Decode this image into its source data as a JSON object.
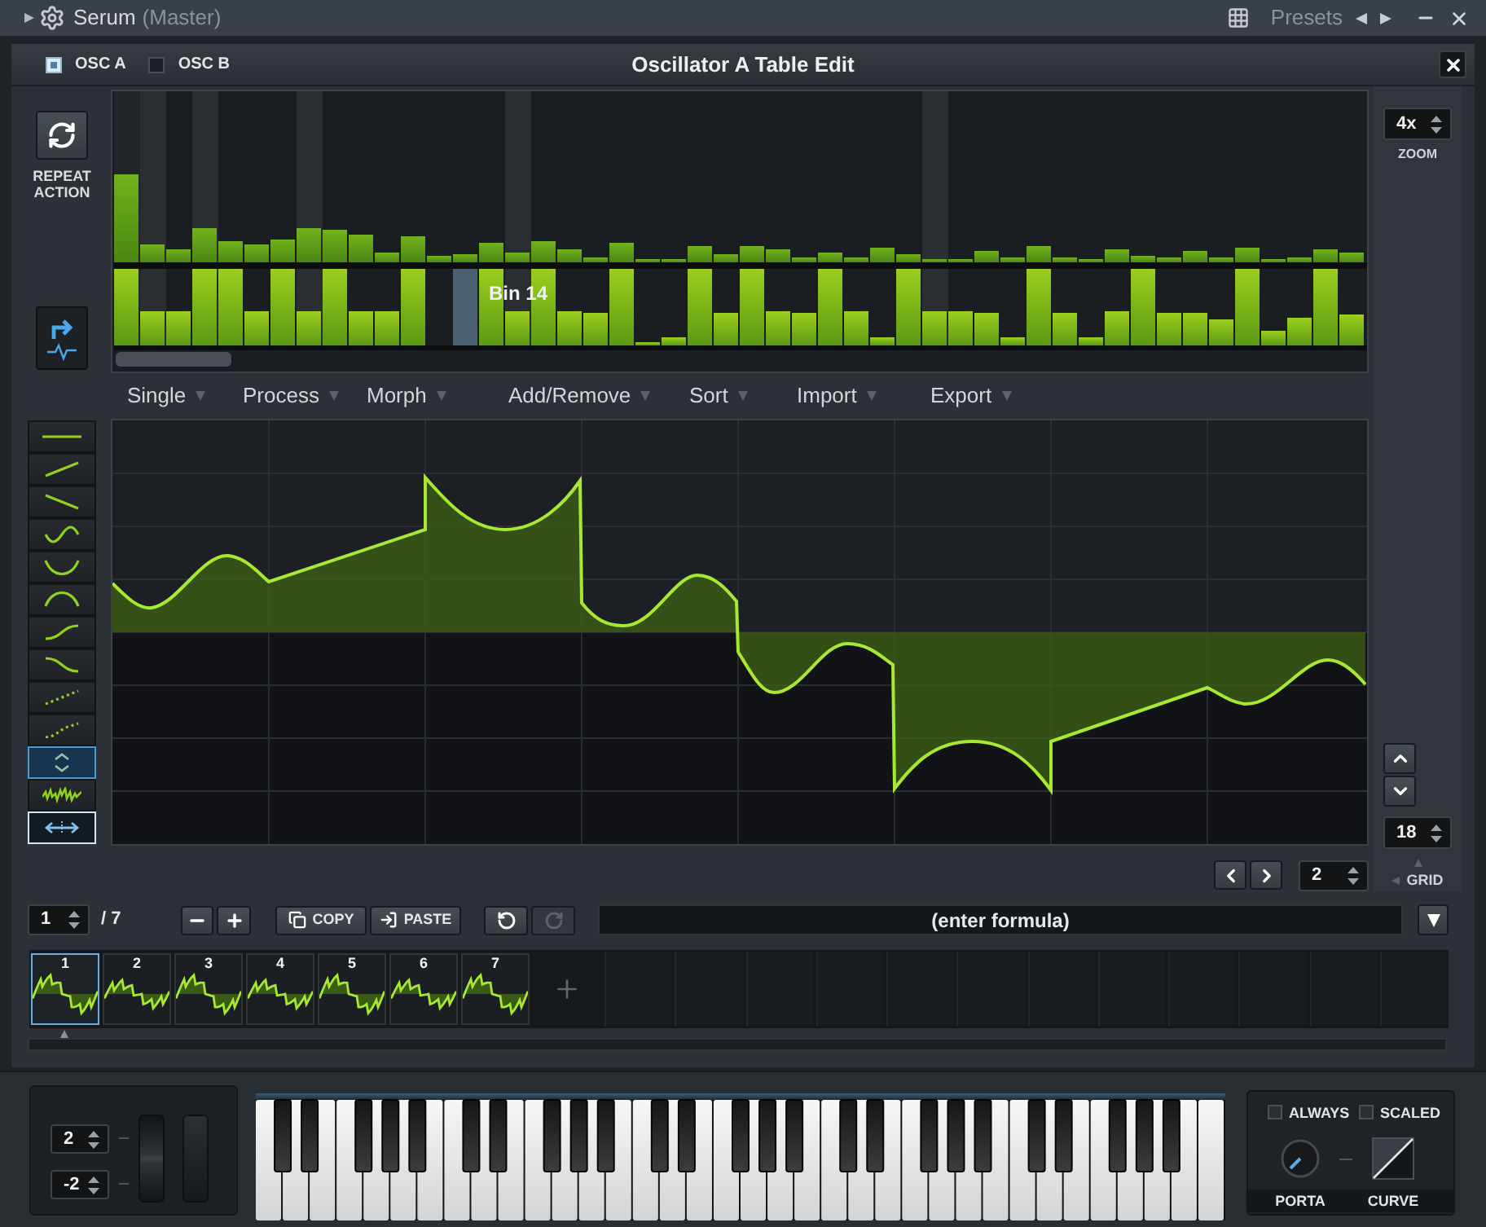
{
  "host_bar": {
    "title": "Serum",
    "subtitle": "(Master)",
    "presets_label": "Presets"
  },
  "window": {
    "title": "Oscillator A Table Edit",
    "osc_toggles": [
      {
        "label": "OSC A",
        "checked": true
      },
      {
        "label": "OSC B",
        "checked": false
      }
    ]
  },
  "repeat_action": {
    "label": "REPEAT ACTION"
  },
  "spectrum": {
    "bin_label": "Bin 14"
  },
  "menu": [
    {
      "label": "Single"
    },
    {
      "label": "Process"
    },
    {
      "label": "Morph"
    },
    {
      "label": "Add/Remove"
    },
    {
      "label": "Sort"
    },
    {
      "label": "Import"
    },
    {
      "label": "Export"
    }
  ],
  "tools": [
    {
      "kind": "flat",
      "selected": false
    },
    {
      "kind": "ramp-up",
      "selected": false
    },
    {
      "kind": "ramp-down",
      "selected": false
    },
    {
      "kind": "sine",
      "selected": false
    },
    {
      "kind": "bowl",
      "selected": false
    },
    {
      "kind": "arch",
      "selected": false
    },
    {
      "kind": "s-curve-up",
      "selected": false
    },
    {
      "kind": "s-curve-down",
      "selected": false
    },
    {
      "kind": "dotted-ramp",
      "selected": false
    },
    {
      "kind": "dotted-curve",
      "selected": false
    },
    {
      "kind": "stretch-vertical",
      "selected": true
    },
    {
      "kind": "noise",
      "selected": false
    }
  ],
  "horizontal_tool": {
    "on": true
  },
  "zoom": {
    "value": "4x",
    "label": "ZOOM"
  },
  "grid": {
    "value": "18",
    "label": "GRID"
  },
  "step": {
    "value": "2"
  },
  "frame_nav": {
    "current": "1",
    "total": "/ 7"
  },
  "clipboard": [
    {
      "kind": "copy",
      "label": "COPY"
    },
    {
      "kind": "paste",
      "label": "PASTE"
    }
  ],
  "history": [
    {
      "kind": "undo",
      "disabled": false
    },
    {
      "kind": "redo",
      "disabled": true
    }
  ],
  "formula": {
    "placeholder": "(enter formula)"
  },
  "frames": [
    {
      "label": "1",
      "selected": true
    },
    {
      "label": "2",
      "selected": false
    },
    {
      "label": "3",
      "selected": false
    },
    {
      "label": "4",
      "selected": false
    },
    {
      "label": "5",
      "selected": false
    },
    {
      "label": "6",
      "selected": false
    },
    {
      "label": "7",
      "selected": false
    }
  ],
  "pitch_range": {
    "up": "2",
    "down": "-2"
  },
  "portamento": {
    "options": [
      {
        "label": "ALWAYS",
        "checked": false
      },
      {
        "label": "SCALED",
        "checked": false
      }
    ],
    "knob_label": "PORTA",
    "curve_label": "CURVE"
  }
}
